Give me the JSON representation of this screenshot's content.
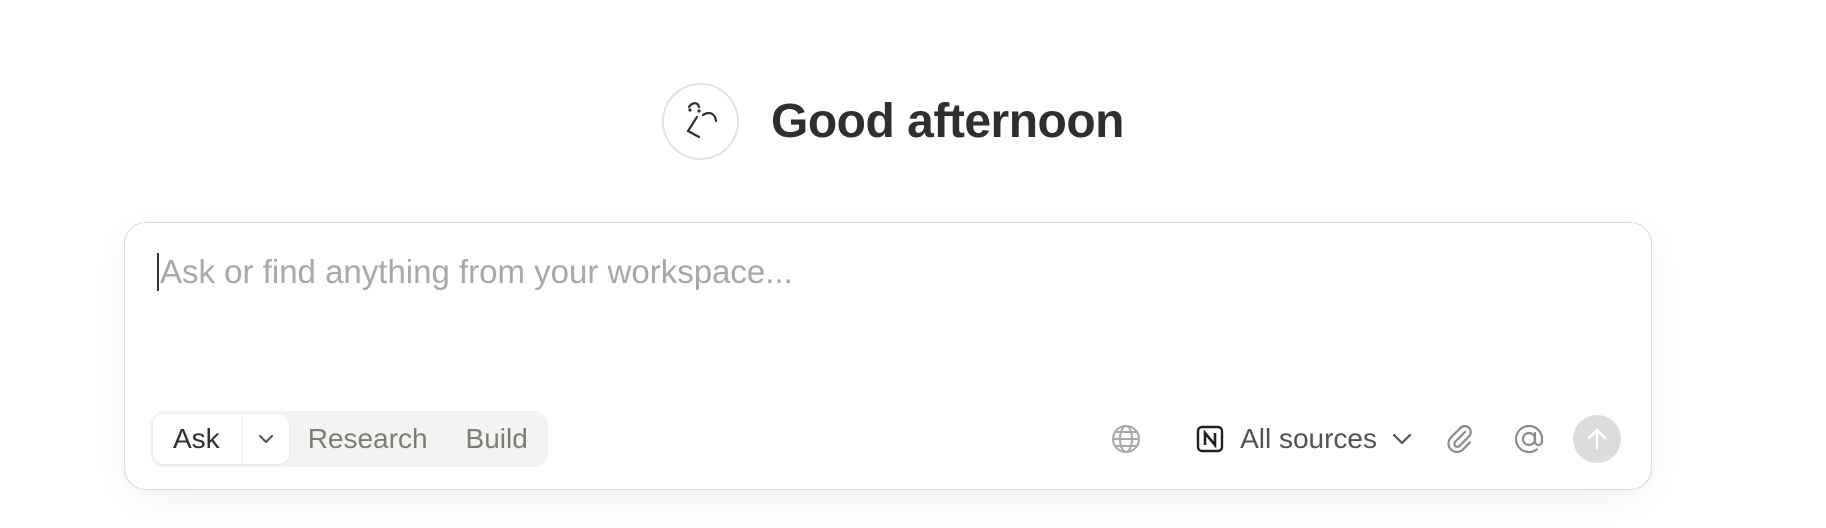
{
  "greeting": {
    "avatar_icon": "face-doodle-icon",
    "title": "Good afternoon"
  },
  "composer": {
    "placeholder": "Ask or find anything from your workspace...",
    "modes": {
      "selected": "Ask",
      "options": [
        "Research",
        "Build"
      ]
    },
    "toolbar": {
      "web_icon": "globe-icon",
      "sources_label": "All sources",
      "sources_logo": "notion-logo-icon",
      "attach_icon": "paperclip-icon",
      "mention_icon": "at-sign-icon",
      "send_icon": "arrow-up-icon"
    }
  },
  "colors": {
    "text_primary": "#2f2f2f",
    "text_placeholder": "#a9a8a5",
    "border": "#dcdcda",
    "mode_group_bg": "#f3f3f1",
    "send_disabled": "#dcdcda"
  }
}
